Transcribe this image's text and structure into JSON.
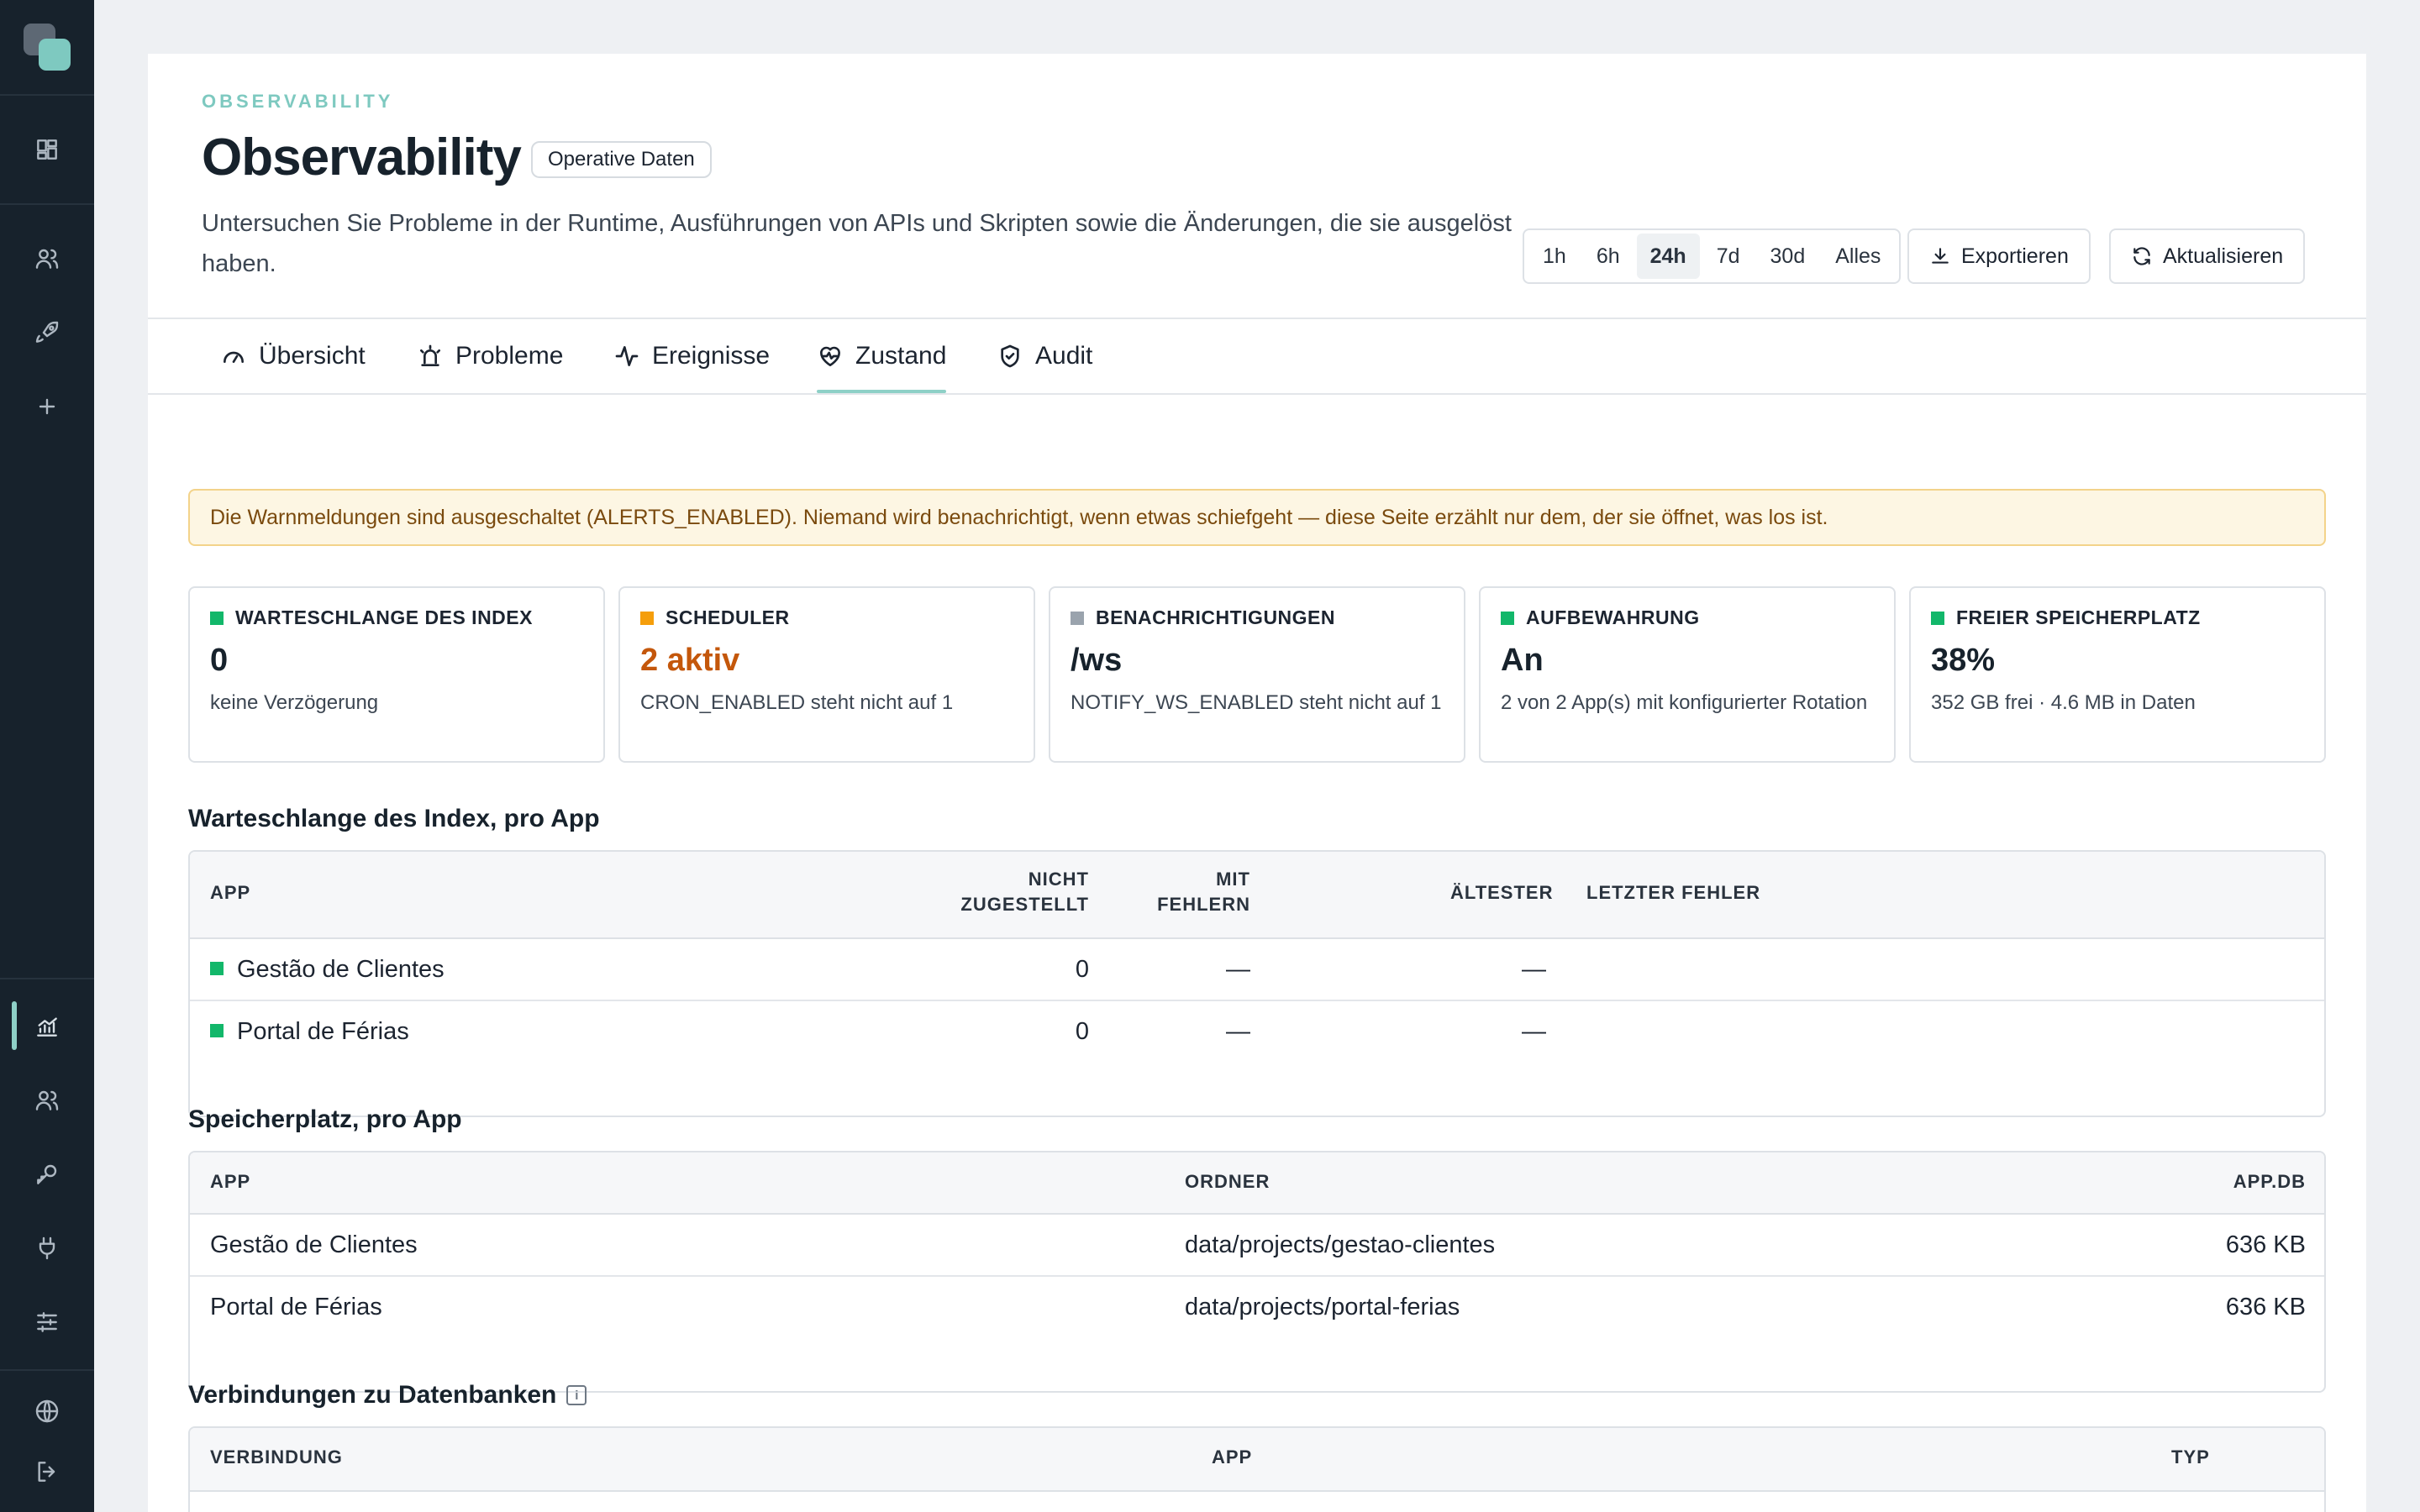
{
  "sidebar": {
    "icons_top": [
      "dashboard-icon",
      "users-icon",
      "rocket-icon",
      "plus-icon"
    ],
    "icons_bottom": [
      "chart-icon",
      "team-icon",
      "key-icon",
      "plug-icon",
      "sliders-icon",
      "globe-icon",
      "logout-icon"
    ],
    "active": "chart-icon"
  },
  "header": {
    "eyebrow": "OBSERVABILITY",
    "title": "Observability",
    "badge": "Operative Daten",
    "subtitle": "Untersuchen Sie Probleme in der Runtime, Ausführungen von APIs und Skripten sowie die Änderungen, die sie ausgelöst haben."
  },
  "time_ranges": [
    "1h",
    "6h",
    "24h",
    "7d",
    "30d",
    "Alles"
  ],
  "time_range_selected": "24h",
  "actions": {
    "export": "Exportieren",
    "refresh": "Aktualisieren"
  },
  "tabs": [
    {
      "label": "Übersicht",
      "icon": "gauge-icon"
    },
    {
      "label": "Probleme",
      "icon": "siren-icon"
    },
    {
      "label": "Ereignisse",
      "icon": "activity-icon"
    },
    {
      "label": "Zustand",
      "icon": "heart-pulse-icon"
    },
    {
      "label": "Audit",
      "icon": "shield-check-icon"
    }
  ],
  "active_tab": "Zustand",
  "alert": "Die Warnmeldungen sind ausgeschaltet (ALERTS_ENABLED). Niemand wird benachrichtigt, wenn etwas schiefgeht — diese Seite erzählt nur dem, der sie öffnet, was los ist.",
  "stats": [
    {
      "label": "WARTESCHLANGE DES INDEX",
      "value": "0",
      "sub": "keine Verzögerung",
      "color": "#12b76a",
      "warn": false
    },
    {
      "label": "SCHEDULER",
      "value": "2 aktiv",
      "sub": "CRON_ENABLED steht nicht auf 1",
      "color": "#f59e0b",
      "warn": true
    },
    {
      "label": "BENACHRICHTIGUNGEN",
      "value": "/ws",
      "sub": "NOTIFY_WS_ENABLED steht nicht auf 1",
      "color": "#9aa3ad",
      "warn": false
    },
    {
      "label": "AUFBEWAHRUNG",
      "value": "An",
      "sub": "2 von 2 App(s) mit konfigurierter Rotation",
      "color": "#12b76a",
      "warn": false
    },
    {
      "label": "FREIER SPEICHERPLATZ",
      "value": "38%",
      "sub": "352 GB frei · 4.6 MB in Daten",
      "color": "#12b76a",
      "warn": false
    }
  ],
  "queue_section": {
    "title": "Warteschlange des Index, pro App",
    "headers": {
      "app": "APP",
      "undelivered_1": "NICHT",
      "undelivered_2": "ZUGESTELLT",
      "failed_1": "MIT",
      "failed_2": "FEHLERN",
      "oldest": "ÄLTESTER",
      "last_error": "LETZTER FEHLER"
    },
    "rows": [
      {
        "app": "Gestão de Clientes",
        "undelivered": "0",
        "failed": "—",
        "oldest": "—",
        "last_error": ""
      },
      {
        "app": "Portal de Férias",
        "undelivered": "0",
        "failed": "—",
        "oldest": "—",
        "last_error": ""
      }
    ]
  },
  "storage_section": {
    "title": "Speicherplatz, pro App",
    "headers": {
      "app": "APP",
      "folder": "ORDNER",
      "db": "APP.DB"
    },
    "rows": [
      {
        "app": "Gestão de Clientes",
        "folder": "data/projects/gestao-clientes",
        "db": "636 KB"
      },
      {
        "app": "Portal de Férias",
        "folder": "data/projects/portal-ferias",
        "db": "636 KB"
      }
    ]
  },
  "connections_section": {
    "title": "Verbindungen zu Datenbanken",
    "headers": {
      "connection": "VERBINDUNG",
      "app": "APP",
      "type": "TYP"
    }
  }
}
